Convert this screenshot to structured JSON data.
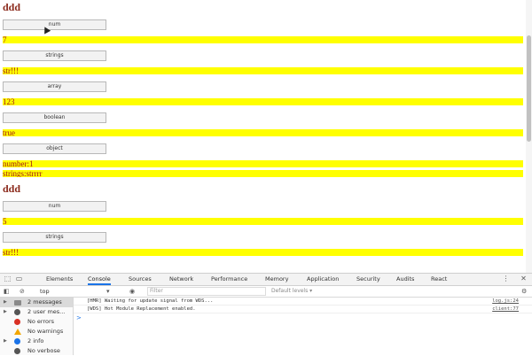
{
  "page": {
    "sections": [
      {
        "title": "ddd",
        "blocks": [
          {
            "button": "num",
            "outputs": [
              "7"
            ]
          },
          {
            "button": "strings",
            "outputs": [
              "str!!!"
            ]
          },
          {
            "button": "array",
            "outputs": [
              "123"
            ]
          },
          {
            "button": "boolean",
            "outputs": [
              "true"
            ]
          },
          {
            "button": "object",
            "outputs": [
              "number:1",
              "strings:strrrr"
            ]
          }
        ]
      },
      {
        "title": "ddd",
        "blocks": [
          {
            "button": "num",
            "outputs": [
              "5"
            ]
          },
          {
            "button": "strings",
            "outputs": [
              "str!!!"
            ]
          }
        ]
      }
    ],
    "colors": {
      "output_background": "#ffff00",
      "output_text": "#a31515",
      "heading": "#8b2a1c"
    }
  },
  "devtools": {
    "tabs": [
      "Elements",
      "Console",
      "Sources",
      "Network",
      "Performance",
      "Memory",
      "Application",
      "Security",
      "Audits",
      "React"
    ],
    "active_tab": "Console",
    "context": "top",
    "filter_placeholder": "Filter",
    "levels": "Default levels ▾",
    "sidebar": [
      {
        "label": "2 messages",
        "icon": "list-icon",
        "color": "#777777"
      },
      {
        "label": "2 user mes...",
        "icon": "user-icon",
        "color": "#555555"
      },
      {
        "label": "No errors",
        "icon": "error-icon",
        "color": "#d93025"
      },
      {
        "label": "No warnings",
        "icon": "warning-icon",
        "color": "#f2a600"
      },
      {
        "label": "2 info",
        "icon": "info-icon",
        "color": "#1a73e8"
      },
      {
        "label": "No verbose",
        "icon": "verbose-icon",
        "color": "#555555"
      }
    ],
    "messages": [
      {
        "text": "[HMR] Waiting for update signal from WDS...",
        "source": "log.js:24"
      },
      {
        "text": "[WDS] Hot Module Replacement enabled.",
        "source": "client:77"
      }
    ],
    "prompt": ">"
  }
}
